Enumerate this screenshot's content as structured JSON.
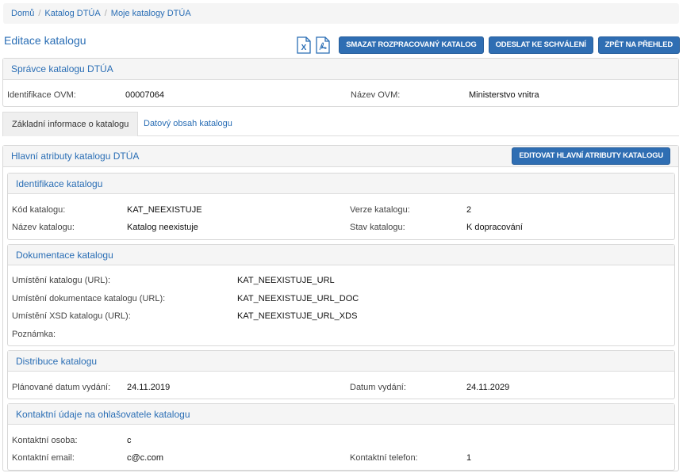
{
  "breadcrumb": {
    "home": "Domů",
    "catalog": "Katalog DTÚA",
    "my_catalogs": "Moje katalogy DTÚA"
  },
  "page": {
    "title": "Editace katalogu"
  },
  "toolbar": {
    "excel_icon": "excel-icon",
    "pdf_icon": "pdf-icon",
    "delete_label": "SMAZAT ROZPRACOVANÝ KATALOG",
    "submit_label": "ODESLAT KE SCHVÁLENÍ",
    "back_label": "ZPĚT NA PŘEHLED"
  },
  "admin": {
    "title": "Správce katalogu DTÚA",
    "ovm_id_label": "Identifikace OVM:",
    "ovm_id_value": "00007064",
    "ovm_name_label": "Název OVM:",
    "ovm_name_value": "Ministerstvo vnitra"
  },
  "tabs": {
    "basic": "Základní informace o katalogu",
    "data": "Datový obsah katalogu"
  },
  "main": {
    "title": "Hlavní atributy katalogu DTÚA",
    "edit_label": "EDITOVAT HLAVNÍ ATRIBUTY KATALOGU"
  },
  "identification": {
    "title": "Identifikace katalogu",
    "code_label": "Kód katalogu:",
    "code_value": "KAT_NEEXISTUJE",
    "version_label": "Verze katalogu:",
    "version_value": "2",
    "name_label": "Název katalogu:",
    "name_value": "Katalog neexistuje",
    "state_label": "Stav katalogu:",
    "state_value": "K dopracování"
  },
  "documentation": {
    "title": "Dokumentace katalogu",
    "url_label": "Umístění katalogu (URL):",
    "url_value": "KAT_NEEXISTUJE_URL",
    "doc_label": "Umístění dokumentace katalogu (URL):",
    "doc_value": "KAT_NEEXISTUJE_URL_DOC",
    "xsd_label": "Umístění XSD katalogu (URL):",
    "xsd_value": "KAT_NEEXISTUJE_URL_XDS",
    "note_label": "Poznámka:"
  },
  "distribution": {
    "title": "Distribuce katalogu",
    "planned_label": "Plánované datum vydání:",
    "planned_value": "24.11.2019",
    "release_label": "Datum vydání:",
    "release_value": "24.11.2029"
  },
  "contact": {
    "title": "Kontaktní údaje na ohlašovatele katalogu",
    "person_label": "Kontaktní osoba:",
    "person_value": "c",
    "email_label": "Kontaktní email:",
    "email_value": "c@c.com",
    "phone_label": "Kontaktní telefon:",
    "phone_value": "1"
  },
  "colors": {
    "primary": "#2f6eb3",
    "link": "#2a6eb5",
    "panel_bg": "#f5f5f5"
  }
}
